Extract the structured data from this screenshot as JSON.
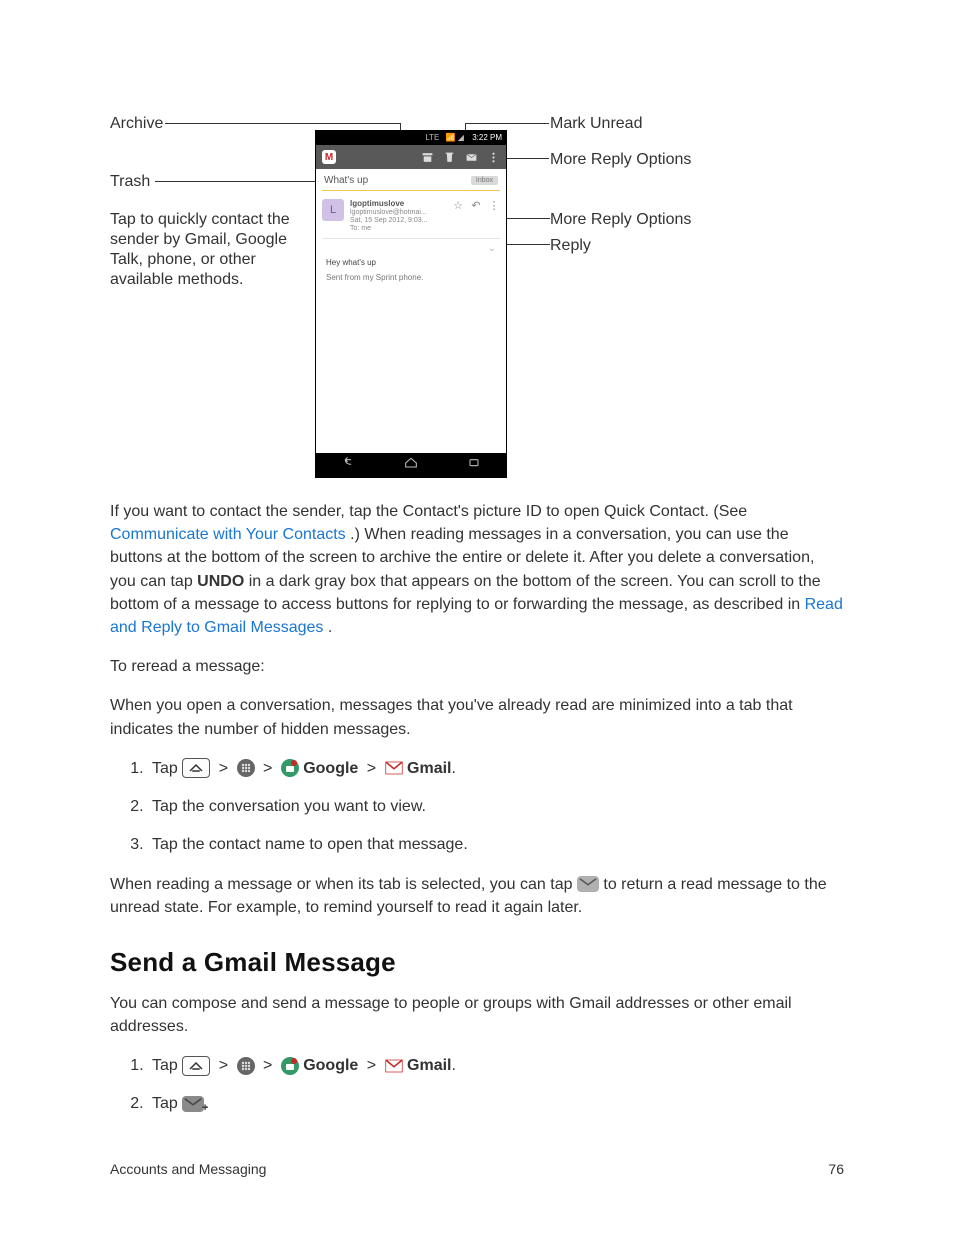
{
  "diagram": {
    "left": {
      "archive": "Archive",
      "trash": "Trash",
      "quick_contact": "Tap to quickly contact the sender by Gmail, Google Talk, phone, or other available methods."
    },
    "right": {
      "mark_unread": "Mark Unread",
      "more_reply1": "More Reply Options",
      "more_reply2": "More Reply Options",
      "reply": "Reply"
    },
    "phone": {
      "status_time": "3:22 PM",
      "status_lte": "LTE",
      "subject": "What's up",
      "inbox_tag": "Inbox",
      "sender_name": "lgoptimuslove",
      "sender_email": "lgoptimuslove@hotmai...",
      "sent_date": "Sat, 15 Sep 2012, 9:03...",
      "to_line": "To: me",
      "body_line1": "Hey what's up",
      "body_line2": "Sent from my Sprint phone."
    }
  },
  "paragraph1": {
    "a": "If you want to contact the sender, tap the Contact's picture ID to open Quick Contact. (See ",
    "link1": "Communicate with Your Contacts",
    "b": ".) When reading messages in a conversation, you can use the buttons at the bottom of the screen to archive the entire or delete it. After you delete a conversation, you can tap ",
    "undo": "UNDO",
    "c": " in a dark gray box that appears on the bottom of the screen. You can scroll to the bottom of a message to access buttons for replying to or forwarding the message, as described in ",
    "link2": "Read and Reply to Gmail Messages",
    "d": "."
  },
  "paragraph2": "To reread a message:",
  "paragraph3": "When you open a conversation, messages that you've already read are minimized into a tab that indicates the number of hidden messages.",
  "steps_a": {
    "s1_tap": "Tap",
    "s1_google": "Google",
    "s1_gmail": "Gmail",
    "s2": "Tap the conversation you want to view.",
    "s3": "Tap the contact name to open that message."
  },
  "paragraph4_a": "When reading a message or when its tab is selected, you can tap ",
  "paragraph4_b": " to return a read message to the unread state. For example, to remind yourself to read it again later.",
  "heading2": "Send a Gmail Message",
  "paragraph5": "You can compose and send a message to people or groups with Gmail addresses or other email addresses.",
  "steps_b": {
    "s1_tap": "Tap",
    "s1_google": "Google",
    "s1_gmail": "Gmail",
    "s2_tap": "Tap"
  },
  "footer": {
    "left": "Accounts and Messaging",
    "right": "76"
  }
}
